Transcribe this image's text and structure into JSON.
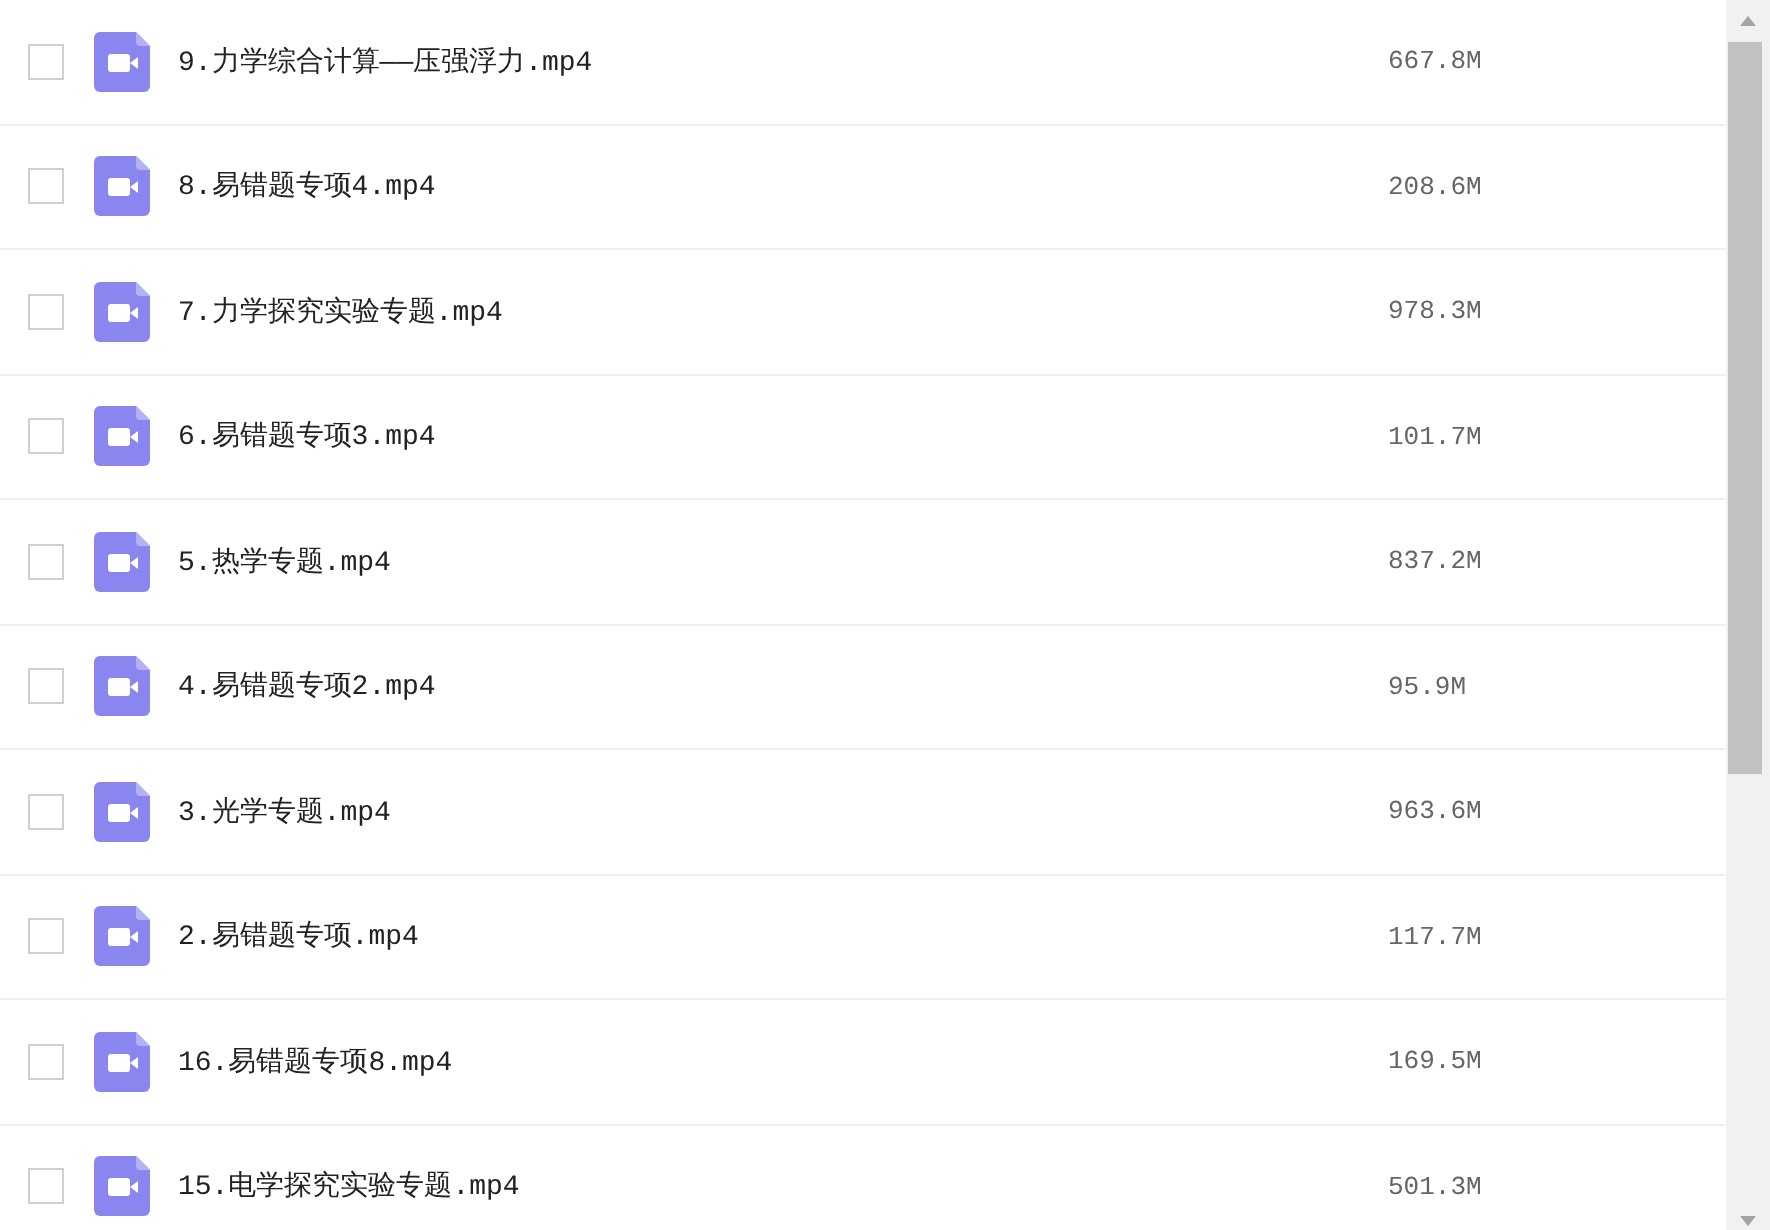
{
  "files": [
    {
      "name": "9.力学综合计算——压强浮力.mp4",
      "size": "667.8M",
      "checked": false
    },
    {
      "name": "8.易错题专项4.mp4",
      "size": "208.6M",
      "checked": false
    },
    {
      "name": "7.力学探究实验专题.mp4",
      "size": "978.3M",
      "checked": false
    },
    {
      "name": "6.易错题专项3.mp4",
      "size": "101.7M",
      "checked": false
    },
    {
      "name": "5.热学专题.mp4",
      "size": "837.2M",
      "checked": false
    },
    {
      "name": "4.易错题专项2.mp4",
      "size": "95.9M",
      "checked": false
    },
    {
      "name": "3.光学专题.mp4",
      "size": "963.6M",
      "checked": false
    },
    {
      "name": "2.易错题专项.mp4",
      "size": "117.7M",
      "checked": false
    },
    {
      "name": "16.易错题专项8.mp4",
      "size": "169.5M",
      "checked": false
    },
    {
      "name": "15.电学探究实验专题.mp4",
      "size": "501.3M",
      "checked": false
    }
  ]
}
